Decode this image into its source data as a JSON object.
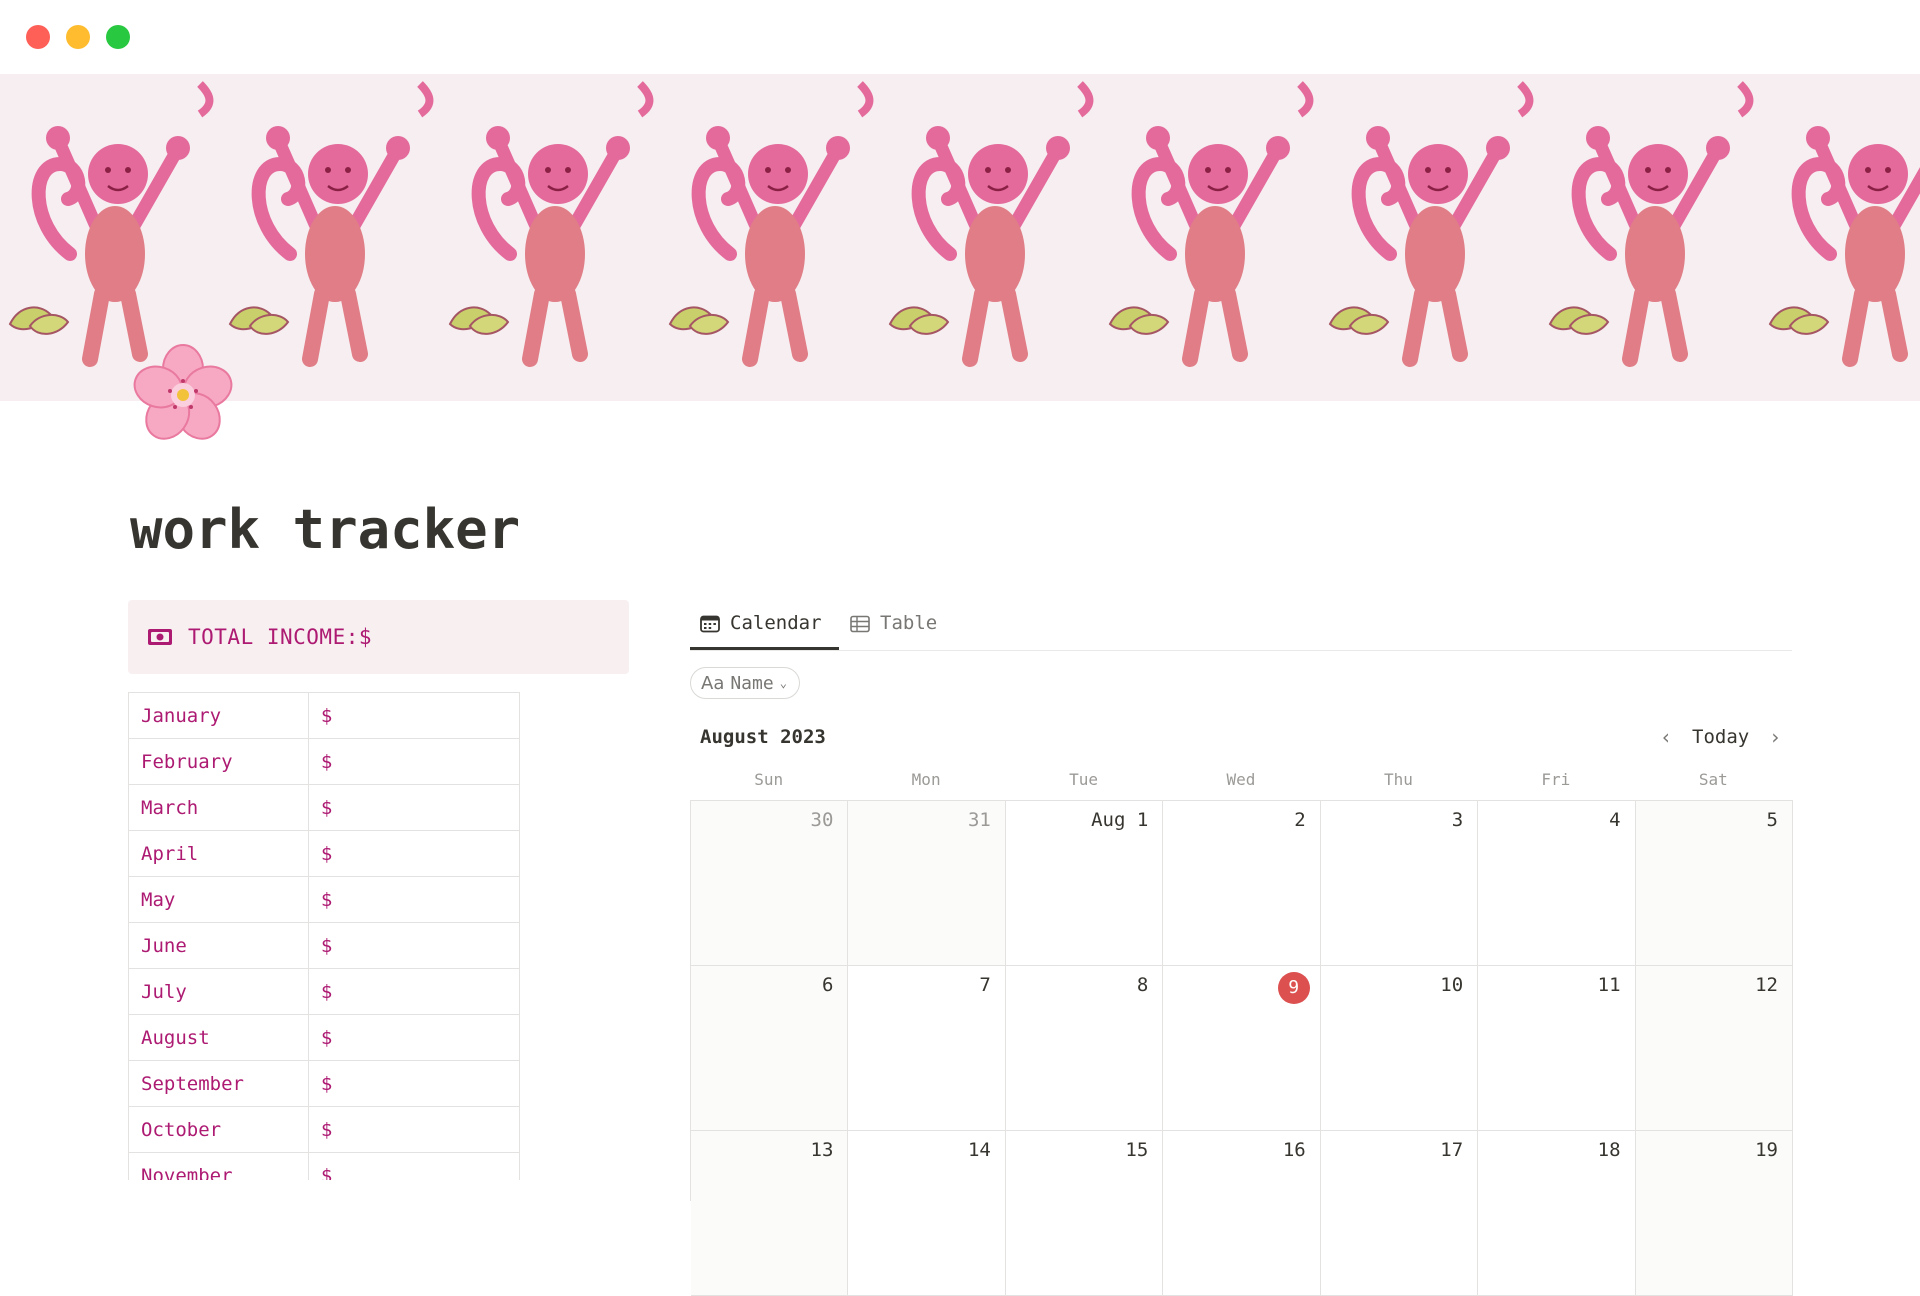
{
  "page": {
    "title": "work tracker",
    "icon": "cherry-blossom-icon"
  },
  "callout": {
    "icon": "money-icon",
    "text": "TOTAL INCOME:$"
  },
  "income_table": {
    "rows": [
      {
        "month": "January",
        "amount": "$"
      },
      {
        "month": "February",
        "amount": "$"
      },
      {
        "month": "March",
        "amount": "$"
      },
      {
        "month": "April",
        "amount": "$"
      },
      {
        "month": "May",
        "amount": "$"
      },
      {
        "month": "June",
        "amount": "$"
      },
      {
        "month": "July",
        "amount": "$"
      },
      {
        "month": "August",
        "amount": "$"
      },
      {
        "month": "September",
        "amount": "$"
      },
      {
        "month": "October",
        "amount": "$"
      },
      {
        "month": "November",
        "amount": "$"
      }
    ]
  },
  "tabs": [
    {
      "label": "Calendar",
      "icon": "calendar-icon",
      "active": true
    },
    {
      "label": "Table",
      "icon": "table-icon",
      "active": false
    }
  ],
  "filter": {
    "prefix": "Aa",
    "label": "Name"
  },
  "calendar": {
    "month_label": "August 2023",
    "today_button": "Today",
    "weekdays": [
      "Sun",
      "Mon",
      "Tue",
      "Wed",
      "Thu",
      "Fri",
      "Sat"
    ],
    "today_date": "9",
    "weeks": [
      [
        {
          "label": "30",
          "in_month": false
        },
        {
          "label": "31",
          "in_month": false
        },
        {
          "label": "Aug 1",
          "in_month": true
        },
        {
          "label": "2",
          "in_month": true
        },
        {
          "label": "3",
          "in_month": true
        },
        {
          "label": "4",
          "in_month": true
        },
        {
          "label": "5",
          "in_month": true
        }
      ],
      [
        {
          "label": "6",
          "in_month": true
        },
        {
          "label": "7",
          "in_month": true
        },
        {
          "label": "8",
          "in_month": true
        },
        {
          "label": "9",
          "in_month": true
        },
        {
          "label": "10",
          "in_month": true
        },
        {
          "label": "11",
          "in_month": true
        },
        {
          "label": "12",
          "in_month": true
        }
      ],
      [
        {
          "label": "13",
          "in_month": true
        },
        {
          "label": "14",
          "in_month": true
        },
        {
          "label": "15",
          "in_month": true
        },
        {
          "label": "16",
          "in_month": true
        },
        {
          "label": "17",
          "in_month": true
        },
        {
          "label": "18",
          "in_month": true
        },
        {
          "label": "19",
          "in_month": true
        }
      ]
    ]
  },
  "colors": {
    "accent_pink": "#ad1a72",
    "callout_bg": "#f8eff1",
    "today_red": "#dc5050"
  }
}
